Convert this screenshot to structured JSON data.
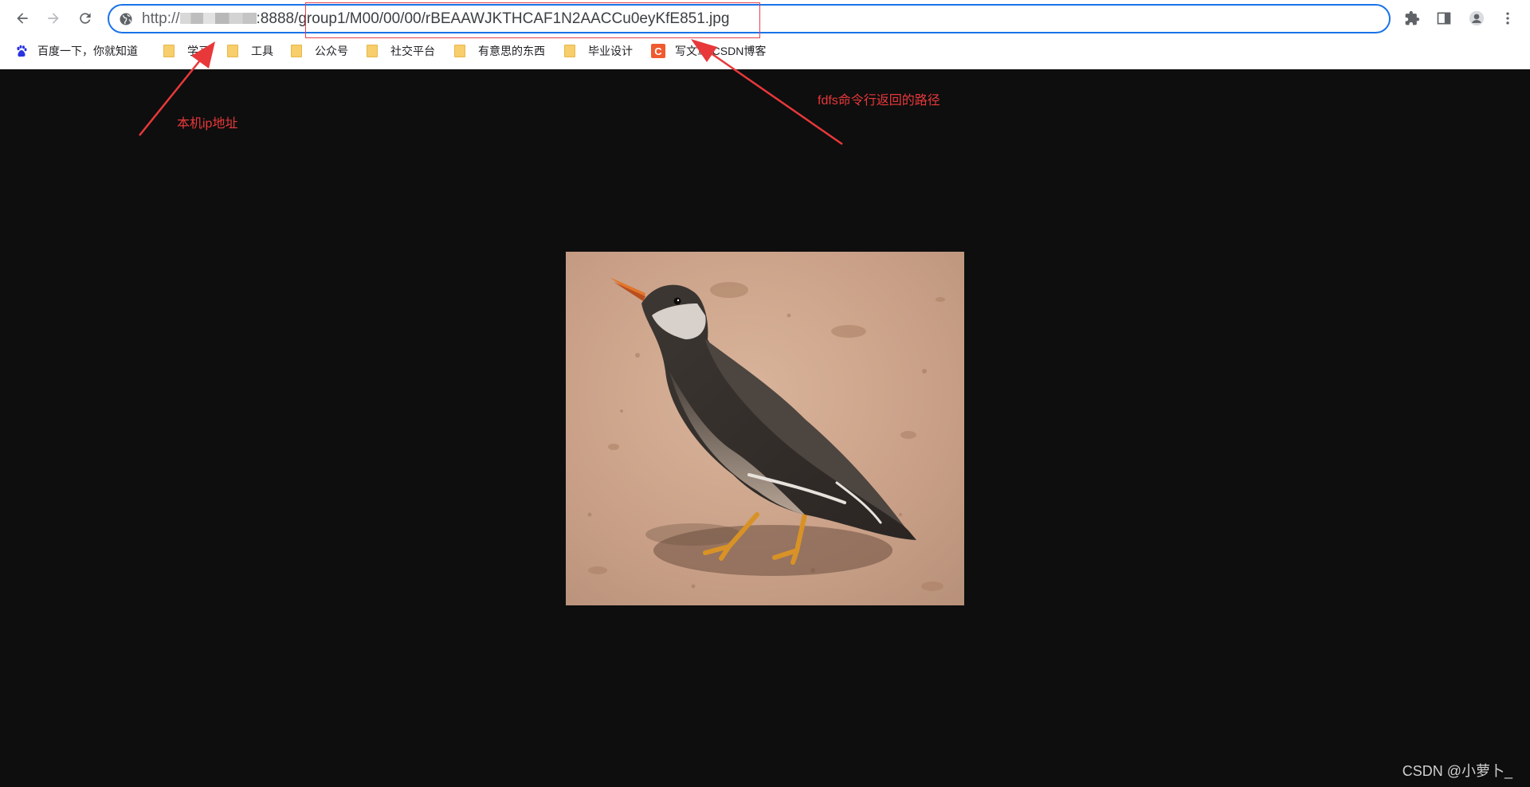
{
  "browser": {
    "address_bar": {
      "url_prefix": "http://",
      "url_port": ":8888",
      "url_path": "/group1/M00/00/00/rBEAAWJKTHCAF1N2AACCu0eyKfE851.jpg"
    },
    "icons": {
      "back": "arrow-left-icon",
      "forward": "arrow-right-icon",
      "reload": "reload-icon",
      "site_info": "globe-icon",
      "extensions": "puzzle-icon",
      "side_panel": "side-panel-icon",
      "profile": "profile-icon",
      "menu": "kebab-menu-icon"
    }
  },
  "bookmarks": [
    {
      "label": "百度一下，你就知道",
      "icon": "baidu-paw-icon"
    },
    {
      "label": "学习",
      "icon": "folder-icon"
    },
    {
      "label": "工具",
      "icon": "folder-icon"
    },
    {
      "label": "公众号",
      "icon": "folder-icon"
    },
    {
      "label": "社交平台",
      "icon": "folder-icon"
    },
    {
      "label": "有意思的东西",
      "icon": "folder-icon"
    },
    {
      "label": "毕业设计",
      "icon": "folder-icon"
    },
    {
      "label": "写文章-CSDN博客",
      "icon": "csdn-icon",
      "icon_letter": "C"
    }
  ],
  "annotations": {
    "ip": "本机ip地址",
    "path": "fdfs命令行返回的路径"
  },
  "watermark": "CSDN @小萝卜_",
  "colors": {
    "annotation": "#e8383a",
    "omnibox_border": "#1a73e8",
    "page_background": "#0e0e0e"
  }
}
